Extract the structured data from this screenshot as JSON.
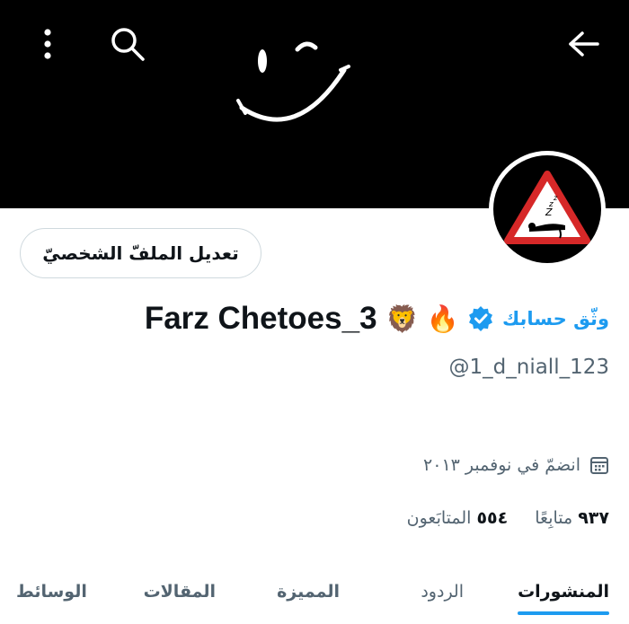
{
  "header": {
    "back_icon": "arrow-left-icon",
    "search_icon": "search-icon",
    "menu_icon": "more-vertical-icon"
  },
  "banner": {
    "image": "winking-smiley-on-black",
    "background": "#000000"
  },
  "avatar": {
    "image": "red-warning-triangle-sleeping-person"
  },
  "profile": {
    "edit_button_label": "تعديل الملفّ الشخصيّ",
    "verify_link": "وثّق حسابك",
    "display_name": "Farz Chetoes_3",
    "name_emojis": "🦁 🔥",
    "handle": "@1_d_niall_123",
    "joined": "انضمّ في نوفمبر ٢٠١٣",
    "following_count": "٥٥٤",
    "following_label": "المتابَعون",
    "followers_count": "٩٣٧",
    "followers_label": "متابِعًا"
  },
  "tabs": [
    {
      "label": "المنشورات",
      "active": true
    },
    {
      "label": "الردود",
      "active": false
    },
    {
      "label": "المميزة",
      "active": false
    },
    {
      "label": "المقالات",
      "active": false
    },
    {
      "label": "الوسائط",
      "active": false
    }
  ],
  "colors": {
    "accent": "#1d9bf0",
    "text": "#0f1419",
    "secondary": "#536471",
    "border": "#cfd9de"
  }
}
